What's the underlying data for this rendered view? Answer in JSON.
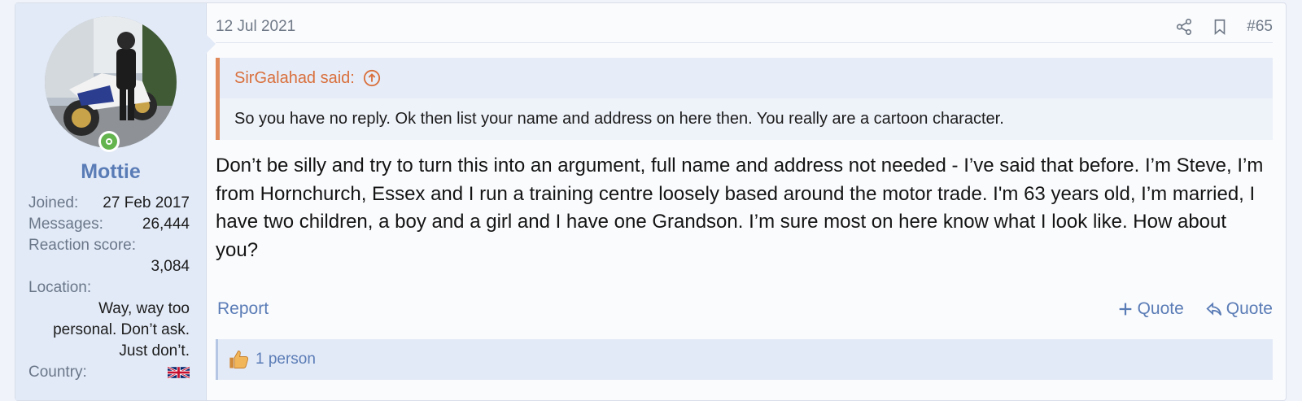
{
  "post": {
    "date": "12 Jul 2021",
    "number": "#65",
    "icons": {
      "share": "share-icon",
      "bookmark": "bookmark-icon"
    }
  },
  "user": {
    "name": "Mottie",
    "status": "online",
    "avatar": "avatar-photo",
    "stats": {
      "joined_label": "Joined:",
      "joined_value": "27 Feb 2017",
      "messages_label": "Messages:",
      "messages_value": "26,444",
      "reaction_label": "Reaction score:",
      "reaction_value": "3,084",
      "location_label": "Location:",
      "location_value": "Way, way too personal. Don’t ask. Just don’t.",
      "country_label": "Country:",
      "country_flag": "uk-flag"
    }
  },
  "quote": {
    "author": "SirGalahad said:",
    "text": "So you have no reply. Ok then list your name and address on here then. You really are a cartoon character."
  },
  "message": "Don’t be silly and try to turn this into an argument, full name and address not needed - I’ve said that before. I’m Steve, I’m from Hornchurch, Essex and I run a training centre loosely based around the motor trade. I'm 63 years old, I’m married, I have two children, a boy and a girl and I have one Grandson. I’m sure most on here know what I look like. How about you?",
  "actions": {
    "report": "Report",
    "multiquote": "Quote",
    "reply_quote": "Quote"
  },
  "reactions": {
    "icon": "thumbs-up-icon",
    "summary": "1 person"
  },
  "colors": {
    "accent": "#5a7cb6",
    "quote_border": "#e0895a",
    "online": "#63b44f"
  }
}
